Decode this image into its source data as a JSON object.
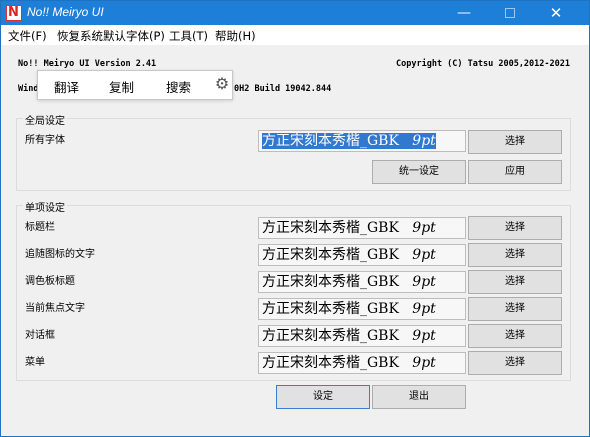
{
  "window": {
    "title": "No!! Meiryo UI",
    "min_glyph": "—",
    "close_glyph": "✕",
    "app_icon_glyph": "N"
  },
  "menu": [
    {
      "label": "文件(F)"
    },
    {
      "label": "恢复系统默认字体(P)"
    },
    {
      "label": "工具(T)"
    },
    {
      "label": "帮助(H)"
    }
  ],
  "header": {
    "version": "No!! Meiryo UI Version 2.41",
    "copyright": "Copyright (C) Tatsu 2005,2012-2021",
    "os_prefix": "Wind",
    "os_suffix": "0H2 Build 19042.844"
  },
  "floatbar": {
    "translate": "翻译",
    "copy": "复制",
    "search": "搜索",
    "settings_icon": "gear-icon",
    "settings_glyph": "⚙"
  },
  "global": {
    "title": "全局设定",
    "all_fonts_label": "所有字体",
    "font_name": "方正宋刻本秀楷_GBK",
    "font_size": "9pt",
    "choose_label": "选择",
    "unify_label": "统一设定",
    "apply_label": "应用"
  },
  "single": {
    "title": "单项设定",
    "choose_label": "选择",
    "items": [
      {
        "label": "标题栏",
        "font_name": "方正宋刻本秀楷_GBK",
        "font_size": "9pt"
      },
      {
        "label": "追随图标的文字",
        "font_name": "方正宋刻本秀楷_GBK",
        "font_size": "9pt"
      },
      {
        "label": "调色板标题",
        "font_name": "方正宋刻本秀楷_GBK",
        "font_size": "9pt"
      },
      {
        "label": "当前焦点文字",
        "font_name": "方正宋刻本秀楷_GBK",
        "font_size": "9pt"
      },
      {
        "label": "对话框",
        "font_name": "方正宋刻本秀楷_GBK",
        "font_size": "9pt"
      },
      {
        "label": "菜单",
        "font_name": "方正宋刻本秀楷_GBK",
        "font_size": "9pt"
      }
    ]
  },
  "footer": {
    "set_label": "设定",
    "exit_label": "退出"
  },
  "colors": {
    "titlebar": "#1e7fd8",
    "selection": "#3078d0"
  }
}
